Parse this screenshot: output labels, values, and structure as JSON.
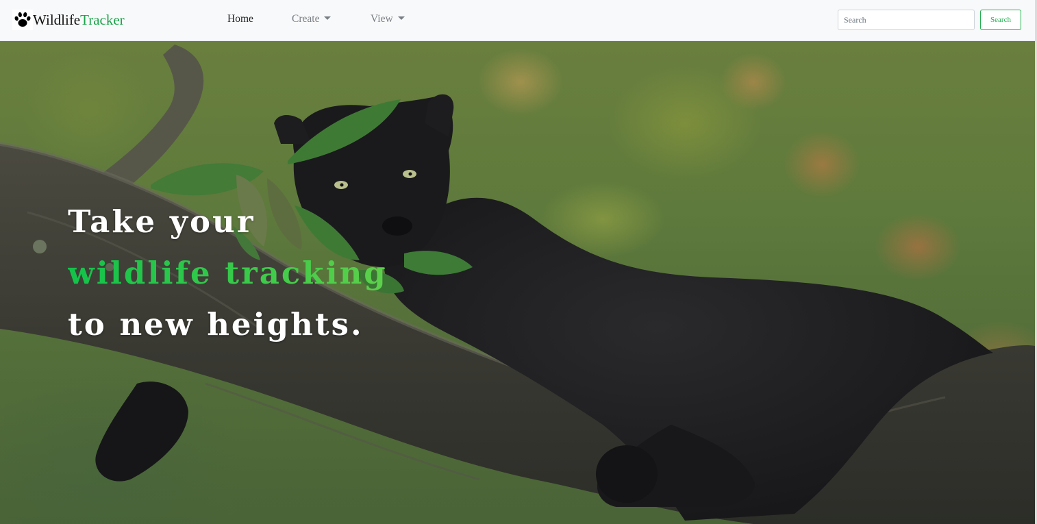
{
  "brand": {
    "name_part1": "Wildlife",
    "name_part2": "Tracker",
    "logo_icon": "paw-icon",
    "accent_color": "#1aa34a"
  },
  "nav": {
    "home": "Home",
    "create": "Create",
    "view": "View"
  },
  "search": {
    "placeholder": "Search",
    "value": "",
    "button_label": "Search",
    "button_color": "#22b04f"
  },
  "hero": {
    "line1": "Take your",
    "line2": "wildlife tracking",
    "line3": "to new heights.",
    "text_color": "#ffffff",
    "accent_color": "#13c24a"
  }
}
